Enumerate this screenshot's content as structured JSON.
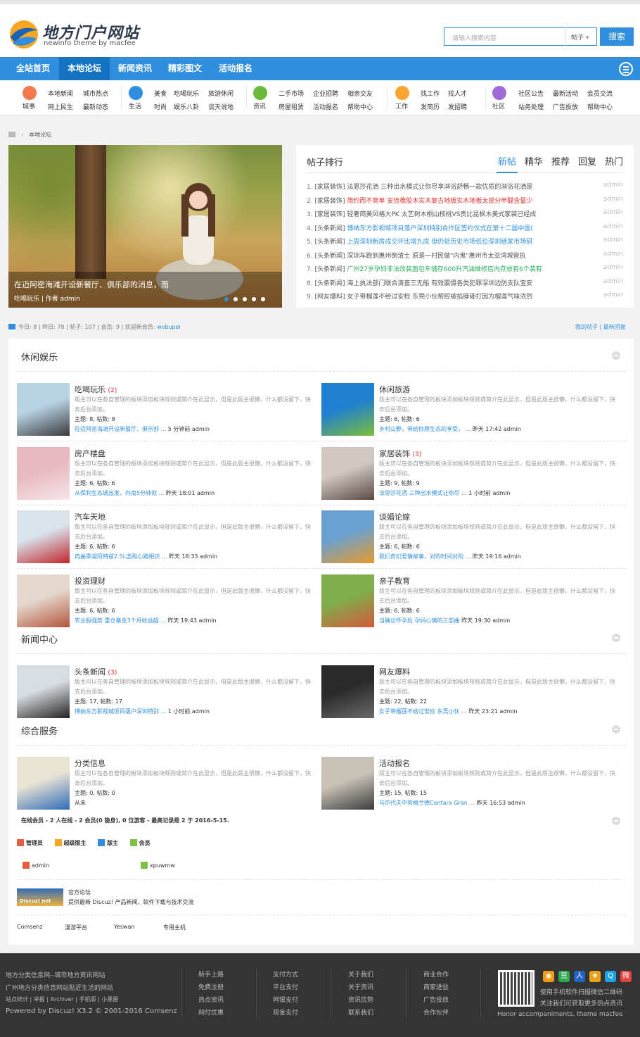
{
  "site": {
    "logo_text": "地方门户网站",
    "logo_sub": "newinfo theme by macfee"
  },
  "search": {
    "placeholder": "请输入搜索内容",
    "type": "帖子",
    "button": "搜索"
  },
  "nav": {
    "items": [
      "全站首页",
      "本地论坛",
      "新闻资讯",
      "精彩图文",
      "活动报名"
    ],
    "active": "本地论坛"
  },
  "subnav": [
    {
      "name": "城事",
      "links": [
        "本地新闻",
        "城市热点",
        "网上民生",
        "最新动态"
      ],
      "color": "#f47a4e"
    },
    {
      "name": "生活",
      "links": [
        "美食",
        "吃喝玩乐",
        "旅游休闲",
        "时尚",
        "娱乐八卦",
        "谈天说地"
      ],
      "color": "#2f8fde"
    },
    {
      "name": "资讯",
      "links": [
        "二手市场",
        "企业招聘",
        "相亲交友",
        "房屋租赁",
        "活动报名",
        "帮助中心"
      ],
      "color": "#6bbb3a"
    },
    {
      "name": "工作",
      "links": [
        "找工作",
        "找人才",
        "发简历",
        "发招聘"
      ],
      "color": "#f8a531"
    },
    {
      "name": "社区",
      "links": [
        "社区公告",
        "最新活动",
        "会员交流",
        "站务处理",
        "广告投放",
        "帮助中心"
      ],
      "color": "#a06bd6"
    }
  ],
  "breadcrumb": "本地论坛",
  "slider": {
    "caption": "在迈阿密海滩开设新餐厅、俱乐部的消息，而",
    "meta": "吃喝玩乐 | 作者 admin"
  },
  "ranking": {
    "title": "帖子排行",
    "tabs": [
      "新帖",
      "精华",
      "推荐",
      "回复",
      "热门"
    ],
    "active_tab": "新帖",
    "rows": [
      {
        "n": "1.",
        "cat": "[家居装饰]",
        "title": "法恩莎花洒 三种出水模式让你尽享淋浴舒畅一款优质的淋浴花洒是",
        "color": "normal",
        "author": "admin"
      },
      {
        "n": "2.",
        "cat": "[家居装饰]",
        "title": "简约而不简单 安信橡胶木实木复古地板实木地板太部分甲醛含量少",
        "color": "red",
        "author": "admin"
      },
      {
        "n": "3.",
        "cat": "[家居装饰]",
        "title": "轻奢简美风格大PK 太艺树木桐山核桃VS贵比昆枫木美式家装已经成",
        "color": "normal",
        "author": "admin"
      },
      {
        "n": "4.",
        "cat": "[头条新闻]",
        "title": "博纳东方影视城项目落户深圳特别合作区签约仪式在第十二届中国(",
        "color": "blue",
        "author": "admin"
      },
      {
        "n": "5.",
        "cat": "[头条新闻]",
        "title": "上周深圳新房成交环比增九成 但仍处历史市场低位深圳链家市场研",
        "color": "blue",
        "author": "admin"
      },
      {
        "n": "6.",
        "cat": "[头条新闻]",
        "title": "深圳车跑到惠州倒渣土 原是一村民做\"内鬼\"惠州市太亚湾城管执",
        "color": "normal",
        "author": "admin"
      },
      {
        "n": "7.",
        "cat": "[头条新闻]",
        "title": "广州27岁孕妇非法改装面包车储存600升汽油维修店内存放有6个装有",
        "color": "green",
        "author": "admin"
      },
      {
        "n": "8.",
        "cat": "[头条新闻]",
        "title": "海上执法部门联合清查三无船 有效震慑各类犯罪深圳边防支队宝安",
        "color": "normal",
        "author": "admin"
      },
      {
        "n": "9.",
        "cat": "[网友爆料]",
        "title": "女子带榴莲不给过安检 东莞小伙帮腔被掐脖砸打因为榴莲气味浓烈",
        "color": "normal",
        "author": "admin"
      }
    ]
  },
  "stats": {
    "text": "今日: 8 | 昨日: 79 | 帖子: 107 | 会员: 9 | 欢迎新会员:",
    "newest_member": "wobupei",
    "links": "我的帖子 | 最新回复"
  },
  "sections": [
    {
      "title": "休闲娱乐",
      "forums": [
        {
          "name": "吃喝玩乐",
          "count": "(2)",
          "desc": "版主可以在各自管理的板块添加板块规则或简介在此显示，但是此版主很懒，什么都没留下，快去后台添加。",
          "counts": "主题: 8, 帖数: 8",
          "last_title": "在迈阿密海滩开设新餐厅、俱乐部 ...",
          "last_time": "5 分钟前 admin"
        },
        {
          "name": "休闲旅游",
          "count": "",
          "desc": "版主可以在各自管理的板块添加板块规则或简介在此显示，但是此版主很懒，什么都没留下，快去后台添加。",
          "counts": "主题: 6, 帖数: 6",
          "last_title": "乡村山野，带给你原生态的享受， ...",
          "last_time": "昨天 17:42 admin"
        },
        {
          "name": "房产楼盘",
          "count": "",
          "desc": "版主可以在各自管理的板块添加板块规则或简介在此显示，但是此版主很懒，什么都没留下，快去后台添加。",
          "counts": "主题: 6, 帖数: 6",
          "last_title": "从保利生态城出发，向南5分钟就 ...",
          "last_time": "昨天 18:01 admin"
        },
        {
          "name": "家居装饰",
          "count": "(3)",
          "desc": "版主可以在各自管理的板块添加板块规则或简介在此显示，但是此版主很懒，什么都没留下，快去后台添加。",
          "counts": "主题: 9, 帖数: 9",
          "last_title": "法恩莎花洒 三种出水模式让你尽 ...",
          "last_time": "1 小时前 admin"
        },
        {
          "name": "汽车天地",
          "count": "",
          "desc": "版主可以在各自管理的板块添加板块规则或简介在此显示，但是此版主很懒，什么都没留下，快去后台添加。",
          "counts": "主题: 6, 帖数: 6",
          "last_title": "冉曲靠凝阿特兹2.5L选购心路相识 ...",
          "last_time": "昨天 18:33 admin"
        },
        {
          "name": "谈婚论嫁",
          "count": "",
          "desc": "版主可以在各自管理的板块添加板块规则或简介在此显示，但是此版主很懒，什么都没留下，快去后台添加。",
          "counts": "主题: 6, 帖数: 6",
          "last_title": "我们奇幻爱情故事，对的时间对的 ...",
          "last_time": "昨天 19:16 admin"
        },
        {
          "name": "投资理财",
          "count": "",
          "desc": "版主可以在各自管理的板块添加板块规则或简介在此显示，但是此版主很懒，什么都没留下，快去后台添加。",
          "counts": "主题: 6, 帖数: 6",
          "last_title": "农业股强势 重仓基金3个月收益超 ...",
          "last_time": "昨天 19:43 admin"
        },
        {
          "name": "亲子教育",
          "count": "",
          "desc": "版主可以在各自管理的板块添加板块规则或简介在此显示，但是此版主很懒，什么都没留下，快去后台添加。",
          "counts": "主题: 6, 帖数: 6",
          "last_title": "当确诊怀孕后 孕妈心情的三部曲",
          "last_time": "昨天 19:30 admin"
        }
      ]
    },
    {
      "title": "新闻中心",
      "forums": [
        {
          "name": "头条新闻",
          "count": "(3)",
          "desc": "版主可以在各自管理的板块添加板块规则或简介在此显示，但是此版主很懒，什么都没留下，快去后台添加。",
          "counts": "主题: 17, 帖数: 17",
          "last_title": "博纳东方影视城项目落户深圳特别 ...",
          "last_time": "1 小时前 admin"
        },
        {
          "name": "网友爆料",
          "count": "",
          "desc": "版主可以在各自管理的板块添加板块规则或简介在此显示，但是此版主很懒，什么都没留下，快去后台添加。",
          "counts": "主题: 22, 帖数: 22",
          "last_title": "女子带榴莲不给过安检 东莞小伙 ...",
          "last_time": "昨天 23:21 admin"
        }
      ]
    },
    {
      "title": "综合服务",
      "forums": [
        {
          "name": "分类信息",
          "count": "",
          "desc": "版主可以在各自管理的板块添加板块规则或简介在此显示，但是此版主很懒，什么都没留下，快去后台添加。",
          "counts": "主题: 0, 帖数: 0",
          "last_title": "",
          "last_time": "从未"
        },
        {
          "name": "活动报名",
          "count": "",
          "desc": "版主可以在各自管理的板块添加板块规则或简介在此显示，但是此版主很懒，什么都没留下，快去后台添加。",
          "counts": "主题: 15, 帖数: 15",
          "last_title": "马尔代夫中央格兰德Centara Gran ...",
          "last_time": "昨天 16:53 admin"
        }
      ]
    }
  ],
  "online": {
    "text": "在线会员 - 2 人在线 - 2 会员(0 隐身), 0 位游客 - 最高记录是 2 于 2016-5-15.",
    "legend": [
      "管理员",
      "超级版主",
      "版主",
      "会员"
    ],
    "users": [
      "admin",
      "xpuwmw"
    ]
  },
  "partner": {
    "logo": "Discuz! net",
    "title": "官方论坛",
    "desc": "提供最新 Discuz! 产品新闻、软件下载与技术交流"
  },
  "friend_links": [
    "Comsenz",
    "漫游平台",
    "Yeswan",
    "专用主机"
  ],
  "footer": {
    "line1": "地方分类信息网--城市地方资讯网站",
    "line2": "广州地方分类信息网站贴近生活的网站",
    "line3": "站点统计 | 举报 | Archiver | 手机版 | 小黑屋",
    "line4": "Powered by Discuz! X3.2 © 2001-2016 Comsenz",
    "cols": [
      [
        "新手上路",
        "免费注册",
        "热点资讯",
        "网付优惠"
      ],
      [
        "支付方式",
        "平台支付",
        "网银支付",
        "现金支付"
      ],
      [
        "关于我们",
        "关于资讯",
        "资讯优势",
        "联系我们"
      ],
      [
        "商业合作",
        "商家进驻",
        "广告投放",
        "合作伙伴"
      ]
    ],
    "qr_text1": "使用手机软件扫描微信二维码",
    "qr_text2": "关注我们可获取更多热点资讯",
    "credit": "Honor accompaniments. theme macfee",
    "social": [
      {
        "name": "rss-icon",
        "glyph": "◉",
        "color": "#f39c12"
      },
      {
        "name": "douban-icon",
        "glyph": "豆",
        "color": "#2fa84f"
      },
      {
        "name": "renren-icon",
        "glyph": "人",
        "color": "#1f64c6"
      },
      {
        "name": "kaixin-icon",
        "glyph": "★",
        "color": "#e8a31b"
      },
      {
        "name": "qq-icon",
        "glyph": "Q",
        "color": "#1ea4ea"
      },
      {
        "name": "weibo-icon",
        "glyph": "微",
        "color": "#e5413f"
      }
    ]
  }
}
